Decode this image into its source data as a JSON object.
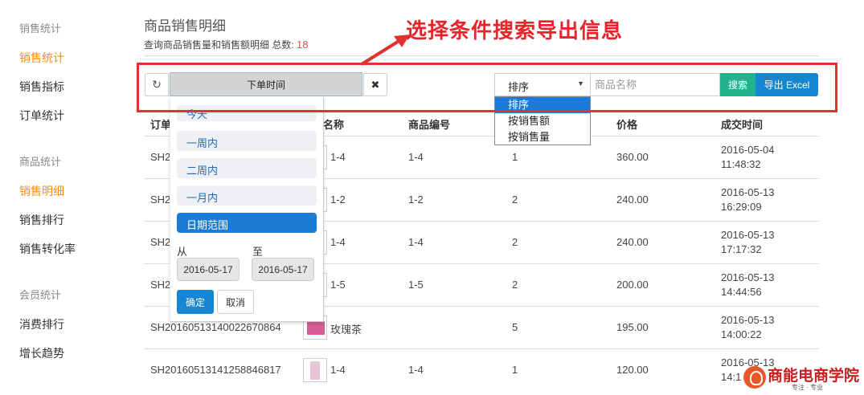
{
  "sidebar": {
    "groups": [
      {
        "title": "销售统计",
        "items": [
          "销售统计",
          "销售指标",
          "订单统计"
        ]
      },
      {
        "title": "商品统计",
        "items": [
          "销售明细",
          "销售排行",
          "销售转化率"
        ]
      },
      {
        "title": "会员统计",
        "items": [
          "消费排行",
          "增长趋势"
        ]
      }
    ],
    "active_items": [
      "销售统计",
      "销售明细"
    ]
  },
  "header": {
    "title": "商品销售明细",
    "subtitle": "查询商品销售量和销售额明细 总数:",
    "total": "18"
  },
  "annotation": "选择条件搜索导出信息",
  "toolbar": {
    "date_button": "下单时间",
    "sort": {
      "selected": "排序",
      "options": [
        "排序",
        "按销售额",
        "按销售量"
      ]
    },
    "name_placeholder": "商品名称",
    "search_label": "搜索",
    "export_label": "导出 Excel"
  },
  "date_panel": {
    "options": [
      "今天",
      "一周内",
      "二周内",
      "一月内",
      "日期范围"
    ],
    "active": "日期范围",
    "from_label": "从",
    "to_label": "至",
    "from_date": "2016-05-17",
    "to_date": "2016-05-17",
    "ok_label": "确定",
    "cancel_label": "取消"
  },
  "table": {
    "headers": [
      "订单",
      "名称",
      "商品编号",
      "",
      "价格",
      "成交时间"
    ],
    "rows": [
      {
        "order": "SH2",
        "name": "1-4",
        "code": "1-4",
        "qty": "1",
        "price": "360.00",
        "date": "2016-05-04",
        "time": "11:48:32"
      },
      {
        "order": "SH2",
        "name": "1-2",
        "code": "1-2",
        "qty": "2",
        "price": "240.00",
        "date": "2016-05-13",
        "time": "16:29:09"
      },
      {
        "order": "SH2",
        "name": "1-4",
        "code": "1-4",
        "qty": "2",
        "price": "240.00",
        "date": "2016-05-13",
        "time": "17:17:32"
      },
      {
        "order": "SH2",
        "name": "1-5",
        "code": "1-5",
        "qty": "2",
        "price": "200.00",
        "date": "2016-05-13",
        "time": "14:44:56"
      },
      {
        "order": "SH20160513140022670864",
        "name": "玫瑰茶",
        "code": "",
        "qty": "5",
        "price": "195.00",
        "date": "2016-05-13",
        "time": "14:00:22"
      },
      {
        "order": "SH20160513141258846817",
        "name": "1-4",
        "code": "1-4",
        "qty": "1",
        "price": "120.00",
        "date": "2016-05-13",
        "time": "14:1"
      }
    ]
  },
  "logo": {
    "text": "商能电商学院",
    "sub": "专注 · 专业"
  }
}
